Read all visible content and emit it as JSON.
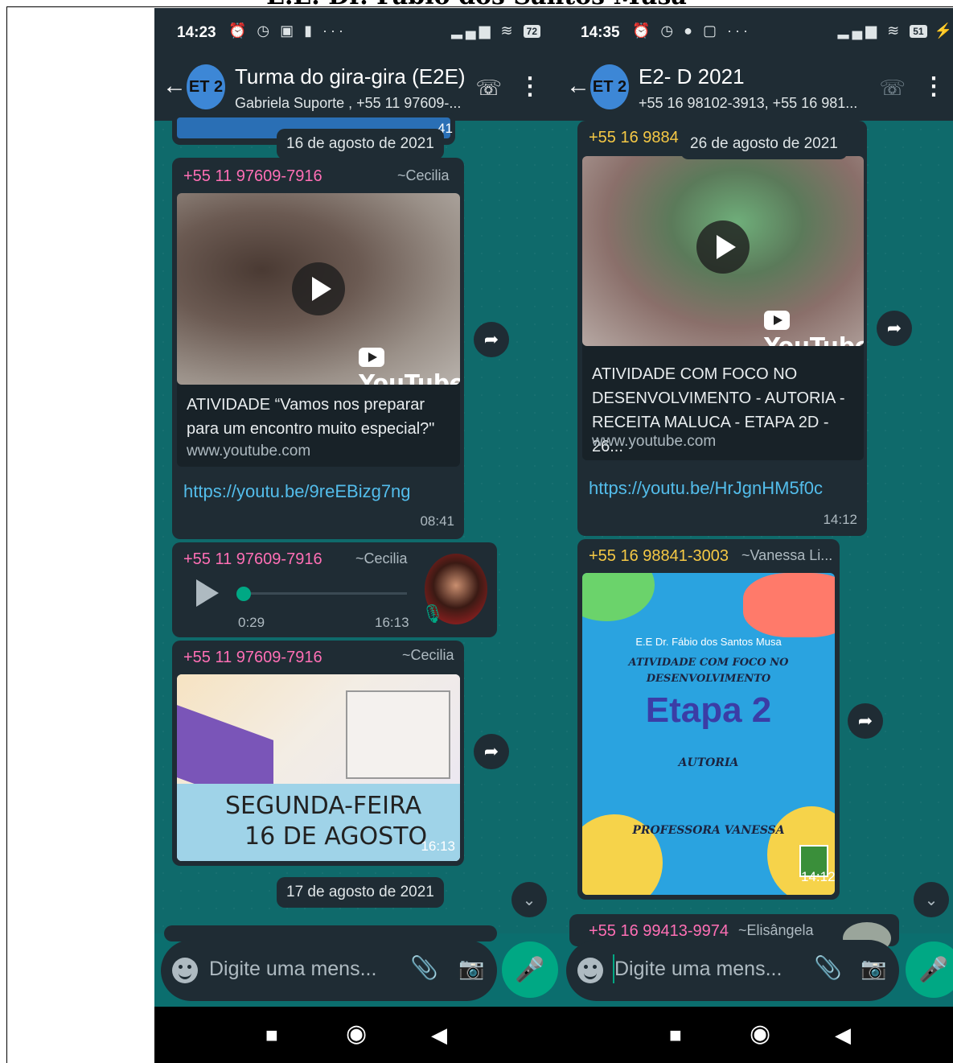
{
  "document": {
    "title": "E.E. Dr. Fábio dos Santos Musa"
  },
  "left": {
    "status": {
      "time": "14:23",
      "icons_left": "⏰ ◷ ▣ ▮ ···",
      "signal": "▂▄▆ ≋",
      "battery": "72"
    },
    "header": {
      "avatar_text": "ET 2",
      "title": "Turma do  gira-gira (E2E)",
      "subtitle": "Gabriela Suporte , +55 11 97609-..."
    },
    "date_chip_1": "16 de agosto de 2021",
    "partial_time": "41",
    "msg1": {
      "sender_phone": "+55 11 97609-7916",
      "sender_name": "~Cecilia",
      "youtube": "YouTube",
      "preview_title": "ATIVIDADE “Vamos nos preparar para um encontro muito especial?\"",
      "preview_domain": "www.youtube.com",
      "link": "https://youtu.be/9reEBizg7ng",
      "time": "08:41"
    },
    "msg2": {
      "sender_phone": "+55 11 97609-7916",
      "sender_name": "~Cecilia",
      "duration": "0:29",
      "time": "16:13"
    },
    "msg3": {
      "sender_phone": "+55 11 97609-7916",
      "sender_name": "~Cecilia",
      "image_text_1": "SEGUNDA-FEIRA",
      "image_text_2": "16 DE AGOSTO",
      "time": "16:13"
    },
    "date_chip_2": "17 de agosto de 2021",
    "input_placeholder": "Digite uma mens..."
  },
  "right": {
    "status": {
      "time": "14:35",
      "icons_left": "⏰ ◷ ● ▢ ···",
      "signal": "▂▄▆ ≋",
      "battery": "51"
    },
    "header": {
      "avatar_text": "ET 2",
      "title": "E2- D 2021",
      "subtitle": "+55 16 98102-3913, +55 16 981..."
    },
    "partial_phone": "+55 16 9884",
    "date_chip_1": "26 de agosto de 2021",
    "msg1": {
      "youtube": "YouTube",
      "preview_title": "ATIVIDADE COM FOCO NO DESENVOLVIMENTO - AUTORIA - RECEITA MALUCA - ETAPA 2D - 26...",
      "preview_domain": "www.youtube.com",
      "link": "https://youtu.be/HrJgnHM5f0c",
      "time": "14:12"
    },
    "msg2": {
      "sender_phone": "+55 16 98841-3003",
      "sender_name": "~Vanessa Li...",
      "card_school": "E.E Dr. Fábio dos Santos Musa",
      "card_line1": "ATIVIDADE COM FOCO NO",
      "card_line2": "DESENVOLVIMENTO",
      "card_stage": "Etapa 2",
      "card_topic": "AUTORIA",
      "card_teacher": "PROFESSORA VANESSA",
      "time": "14:12"
    },
    "msg3": {
      "sender_phone": "+55 16 99413-9974",
      "sender_name": "~Elisângela"
    },
    "input_placeholder": "Digite uma mens..."
  },
  "colors": {
    "accent": "#00a884",
    "header": "#1f2c34",
    "wallpaper": "#0f6a6b",
    "link": "#53bdeb",
    "phone_left": "#ff6fb5",
    "phone_right": "#f6c945"
  }
}
